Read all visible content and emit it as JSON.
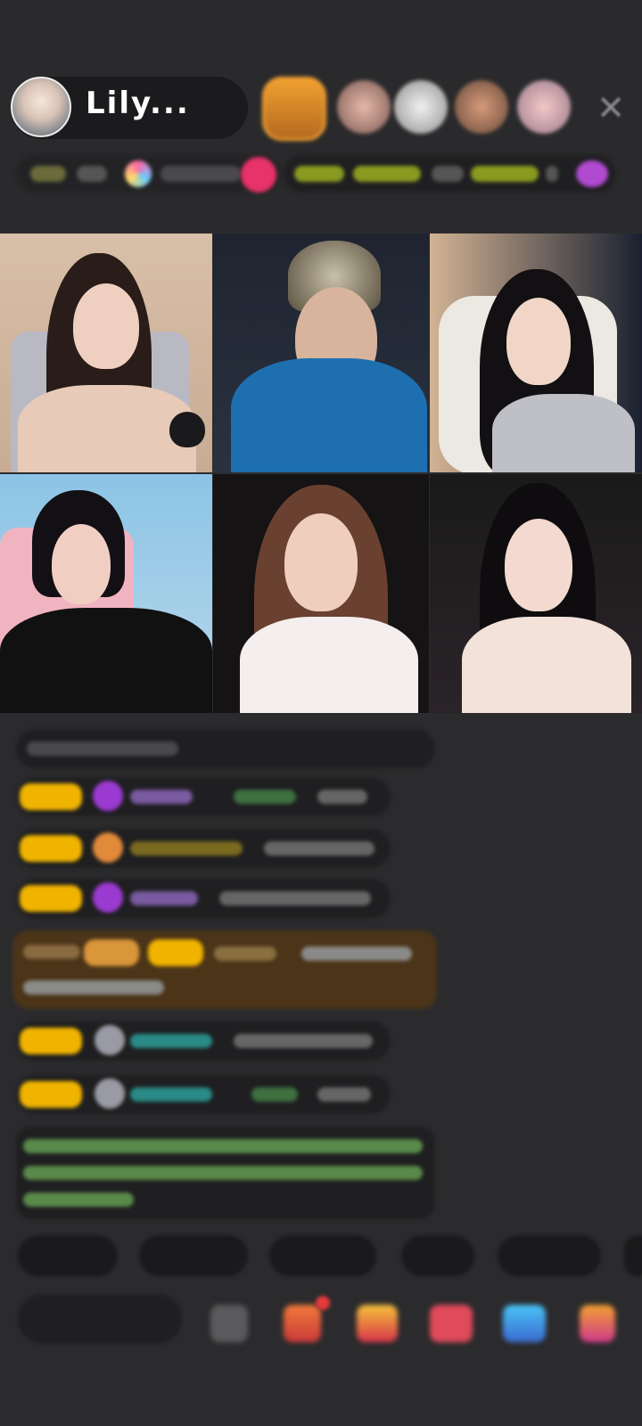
{
  "host": {
    "name": "Lily..."
  },
  "colors": {
    "background": "#2b2b2d",
    "badge": "#f0b400",
    "gift_highlight": "#4b3418"
  }
}
